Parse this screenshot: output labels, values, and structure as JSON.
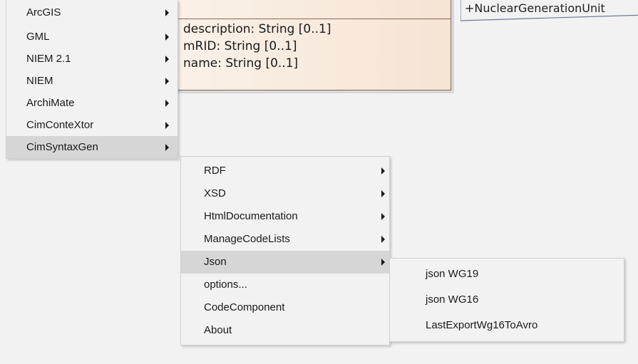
{
  "diagram": {
    "class_attributes": [
      "description: String [0..1]",
      "mRID: String [0..1]",
      "name: String [0..1]"
    ],
    "association_label": "+NuclearGenerationUnit"
  },
  "menu1": {
    "items": [
      {
        "label": "ArcGIS",
        "submenu": true
      },
      {
        "label": "GML",
        "submenu": true
      },
      {
        "label": "NIEM 2.1",
        "submenu": true
      },
      {
        "label": "NIEM",
        "submenu": true
      },
      {
        "label": "ArchiMate",
        "submenu": true
      },
      {
        "label": "CimConteXtor",
        "submenu": true
      },
      {
        "label": "CimSyntaxGen",
        "submenu": true,
        "active": true
      }
    ]
  },
  "menu2": {
    "items": [
      {
        "label": "RDF",
        "submenu": true
      },
      {
        "label": "XSD",
        "submenu": true
      },
      {
        "label": "HtmlDocumentation",
        "submenu": true
      },
      {
        "label": "ManageCodeLists",
        "submenu": true
      },
      {
        "label": "Json",
        "submenu": true,
        "active": true
      },
      {
        "label": "options...",
        "submenu": false
      },
      {
        "label": "CodeComponent",
        "submenu": false
      },
      {
        "label": "About",
        "submenu": false
      }
    ]
  },
  "menu3": {
    "items": [
      {
        "label": "json WG19"
      },
      {
        "label": "json WG16"
      },
      {
        "label": "LastExportWg16ToAvro"
      }
    ]
  }
}
